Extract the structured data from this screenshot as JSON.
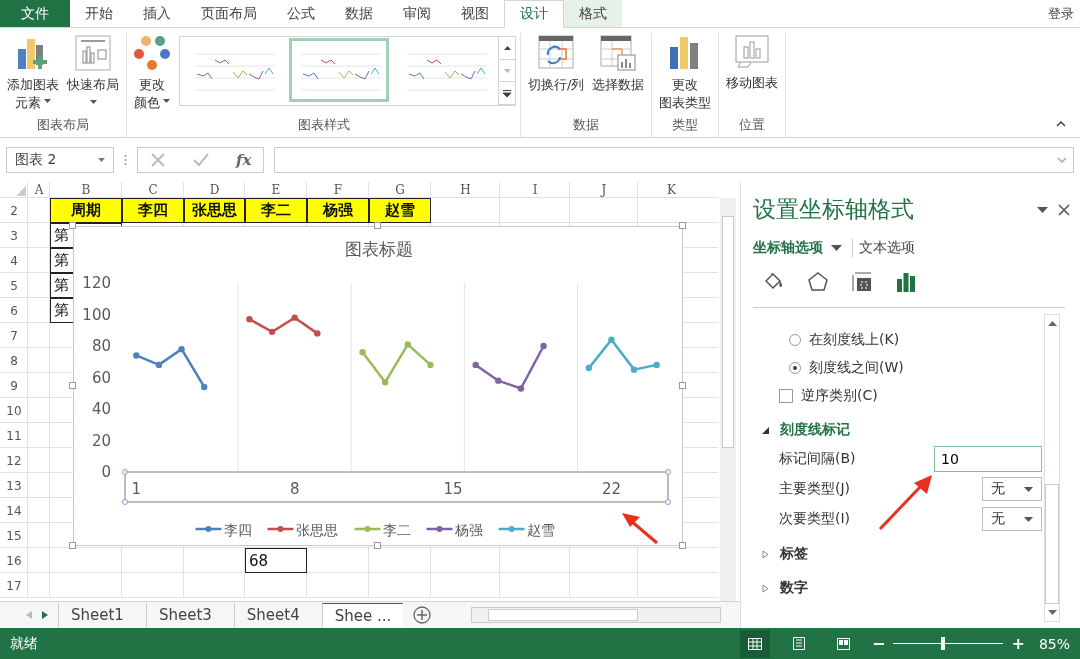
{
  "ribbon_tabs": [
    {
      "label": "文件",
      "kind": "file",
      "selected": false
    },
    {
      "label": "开始",
      "kind": "tab",
      "selected": false
    },
    {
      "label": "插入",
      "kind": "tab",
      "selected": false
    },
    {
      "label": "页面布局",
      "kind": "tab",
      "selected": false
    },
    {
      "label": "公式",
      "kind": "tab",
      "selected": false
    },
    {
      "label": "数据",
      "kind": "tab",
      "selected": false
    },
    {
      "label": "审阅",
      "kind": "tab",
      "selected": false
    },
    {
      "label": "视图",
      "kind": "tab",
      "selected": false
    },
    {
      "label": "设计",
      "kind": "context",
      "selected": true
    },
    {
      "label": "格式",
      "kind": "context",
      "selected": false
    }
  ],
  "sign_in": "登录",
  "ribbon_groups": [
    {
      "label": "图表布局",
      "buttons": [
        {
          "lines": [
            "添加图表",
            "元素"
          ],
          "dropdown": true
        },
        {
          "lines": [
            "快速布局"
          ],
          "dropdown": true
        }
      ]
    },
    {
      "label": "图表样式",
      "buttons": [
        {
          "lines": [
            "更改",
            "颜色"
          ],
          "dropdown": true
        }
      ],
      "gallery": [
        {
          "selected": false
        },
        {
          "selected": true
        },
        {
          "selected": false
        }
      ]
    },
    {
      "label": "数据",
      "buttons": [
        {
          "lines": [
            "切换行/列"
          ],
          "dropdown": false
        },
        {
          "lines": [
            "选择数据"
          ],
          "dropdown": false
        }
      ]
    },
    {
      "label": "类型",
      "buttons": [
        {
          "lines": [
            "更改",
            "图表类型"
          ],
          "dropdown": false
        }
      ]
    },
    {
      "label": "位置",
      "buttons": [
        {
          "lines": [
            "移动图表"
          ],
          "dropdown": false
        }
      ]
    }
  ],
  "formula_bar": {
    "name_box": "图表 2",
    "fx": "fx"
  },
  "sheet": {
    "columns": [
      "A",
      "B",
      "C",
      "D",
      "E",
      "F",
      "G",
      "H",
      "I",
      "J",
      "K"
    ],
    "rows": [
      {
        "number": "2",
        "kind": "header",
        "cells": [
          "",
          "周期",
          "李四",
          "张思思",
          "李二",
          "杨强",
          "赵雪"
        ]
      },
      {
        "number": "3",
        "kind": "data",
        "cells": [
          "",
          "第"
        ]
      },
      {
        "number": "4",
        "kind": "data",
        "cells": [
          "",
          "第"
        ]
      },
      {
        "number": "5",
        "kind": "data",
        "cells": [
          "",
          "第"
        ]
      },
      {
        "number": "6",
        "kind": "data",
        "cells": [
          "",
          "第"
        ]
      },
      {
        "number": "7"
      },
      {
        "number": "8"
      },
      {
        "number": "9"
      },
      {
        "number": "10"
      },
      {
        "number": "11"
      },
      {
        "number": "12"
      },
      {
        "number": "13"
      },
      {
        "number": "14"
      },
      {
        "number": "15"
      },
      {
        "number": "16",
        "kind": "data",
        "cells": [
          "",
          "",
          "",
          "",
          "68"
        ]
      },
      {
        "number": "17"
      }
    ]
  },
  "chart": {
    "chart_data": {
      "type": "line",
      "title": "图表标题",
      "legend": "bottom",
      "x": [
        1,
        2,
        3,
        4,
        5,
        6,
        7,
        8,
        9,
        10,
        11,
        12,
        13,
        14,
        15,
        16,
        17,
        18,
        19,
        20,
        21,
        22,
        23,
        24
      ],
      "series": [
        {
          "name": "李四",
          "color": "#4f81bd",
          "marker": "circle",
          "values": [
            74,
            68,
            78,
            54,
            null,
            null,
            null,
            null,
            null,
            null,
            null,
            null,
            null,
            null,
            null,
            null,
            null,
            null,
            null,
            null,
            null,
            null,
            null,
            null
          ]
        },
        {
          "name": "张思思",
          "color": "#c0504d",
          "marker": "circle",
          "values": [
            null,
            null,
            null,
            null,
            null,
            97,
            89,
            98,
            88,
            null,
            null,
            null,
            null,
            null,
            null,
            null,
            null,
            null,
            null,
            null,
            null,
            null,
            null,
            null
          ]
        },
        {
          "name": "李二",
          "color": "#9bbb59",
          "marker": "circle",
          "values": [
            null,
            null,
            null,
            null,
            null,
            null,
            null,
            null,
            null,
            null,
            76,
            57,
            81,
            68,
            null,
            null,
            null,
            null,
            null,
            null,
            null,
            null,
            null,
            null
          ]
        },
        {
          "name": "杨强",
          "color": "#8064a2",
          "marker": "circle",
          "values": [
            null,
            null,
            null,
            null,
            null,
            null,
            null,
            null,
            null,
            null,
            null,
            null,
            null,
            null,
            null,
            68,
            58,
            53,
            80,
            null,
            null,
            null,
            null,
            null
          ]
        },
        {
          "name": "赵雪",
          "color": "#4bacc6",
          "marker": "circle",
          "values": [
            null,
            null,
            null,
            null,
            null,
            null,
            null,
            null,
            null,
            null,
            null,
            null,
            null,
            null,
            null,
            null,
            null,
            null,
            null,
            null,
            66,
            84,
            65,
            68
          ]
        }
      ],
      "xlim": [
        0.5,
        24.5
      ],
      "ylim": [
        0,
        120
      ],
      "yticks": [
        0,
        20,
        40,
        60,
        80,
        100,
        120
      ],
      "xticks": [
        1,
        8,
        15,
        22
      ]
    }
  },
  "sheet_tabs": [
    {
      "label": "Sheet1",
      "selected": false
    },
    {
      "label": "Sheet3",
      "selected": false
    },
    {
      "label": "Sheet4",
      "selected": false
    },
    {
      "label": "Shee ...",
      "selected": true
    }
  ],
  "format_pane": {
    "title": "设置坐标轴格式",
    "tabs": [
      {
        "label": "坐标轴选项",
        "selected": true,
        "dropdown": true
      },
      {
        "label": "文本选项",
        "selected": false,
        "dropdown": false
      }
    ],
    "icon_tabs": [
      {
        "selected": false
      },
      {
        "selected": false
      },
      {
        "selected": false
      },
      {
        "selected": true
      }
    ],
    "options": [
      {
        "kind": "radio",
        "label": "在刻度线上(K)",
        "checked": false
      },
      {
        "kind": "radio",
        "label": "刻度线之间(W)",
        "checked": true
      },
      {
        "kind": "checkbox",
        "label": "逆序类别(C)",
        "checked": false
      },
      {
        "kind": "section",
        "label": "刻度线标记",
        "expanded": true
      },
      {
        "kind": "input",
        "label": "标记间隔(B)",
        "value": "10"
      },
      {
        "kind": "select",
        "label": "主要类型(J)",
        "value": "无"
      },
      {
        "kind": "select",
        "label": "次要类型(I)",
        "value": "无"
      },
      {
        "kind": "section",
        "label": "标签",
        "expanded": false
      },
      {
        "kind": "section",
        "label": "数字",
        "expanded": false
      }
    ]
  },
  "status_bar": {
    "text": "就绪",
    "views": [
      {
        "selected": true
      },
      {
        "selected": false
      },
      {
        "selected": false
      }
    ],
    "zoom": {
      "minus": "−",
      "plus": "+",
      "level": 0.45,
      "reading": "85%"
    }
  }
}
